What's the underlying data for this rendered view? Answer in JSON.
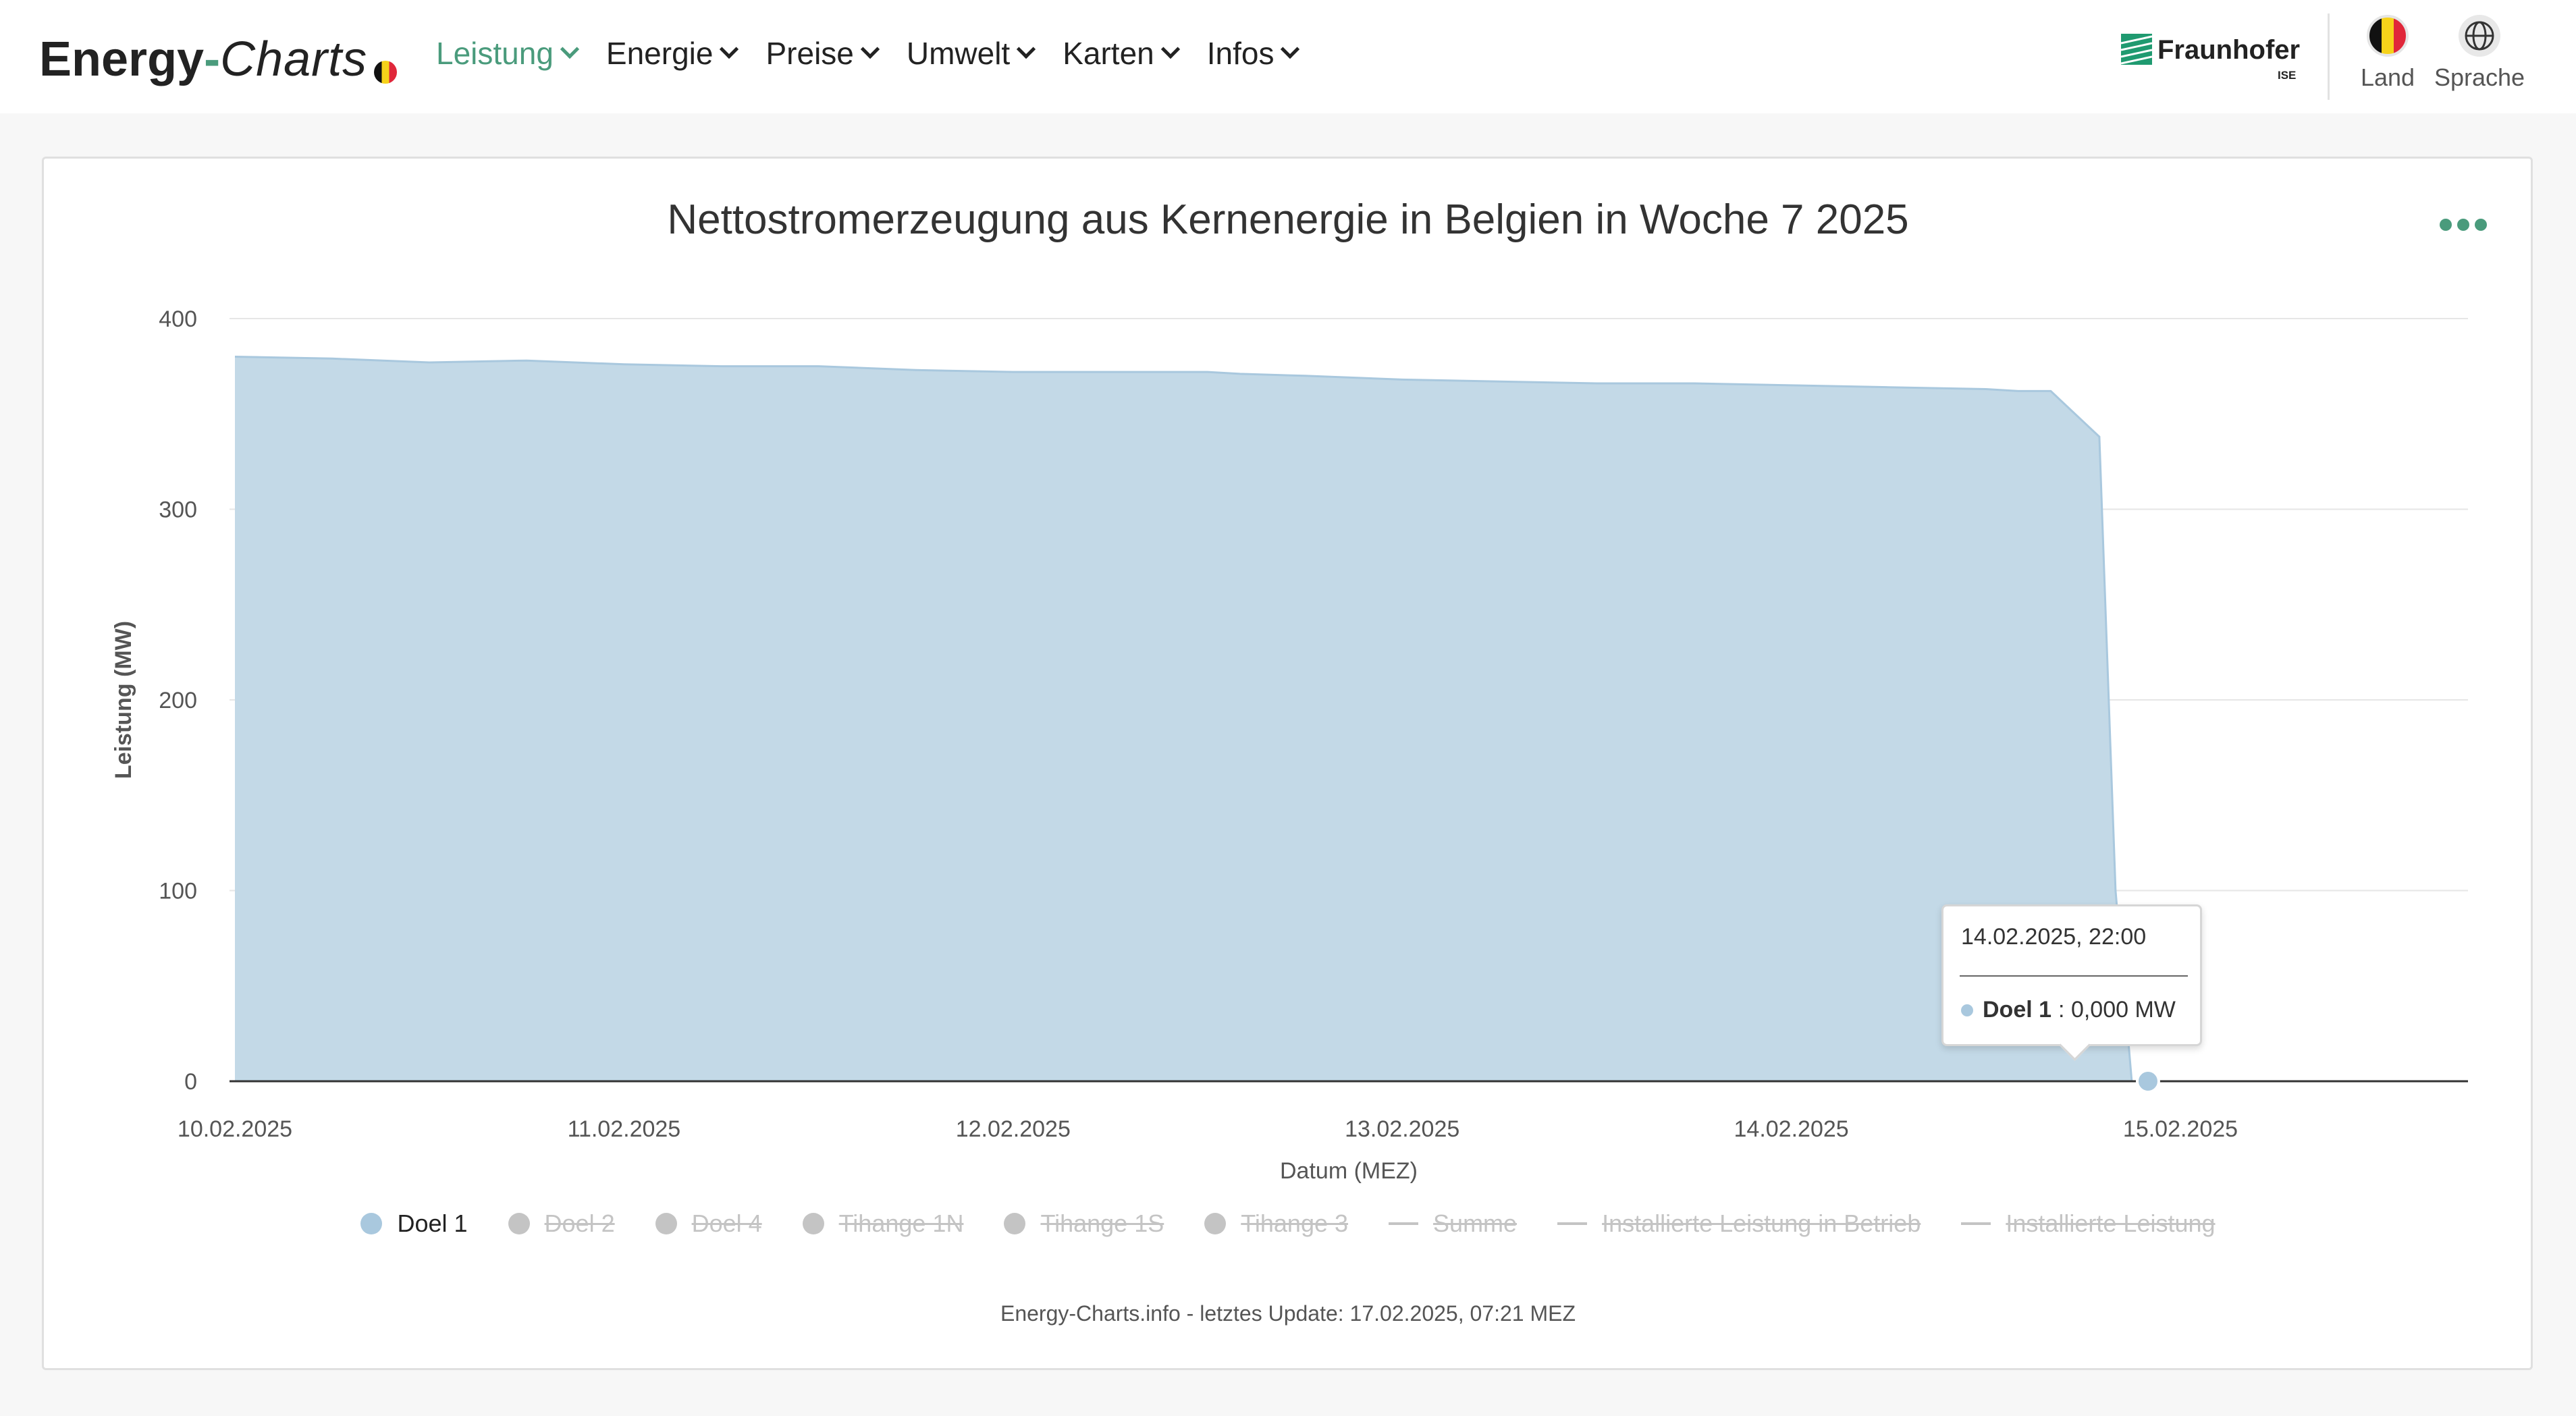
{
  "header": {
    "logo": {
      "part1": "Energy",
      "part2": "-",
      "part3": "Charts"
    },
    "nav": [
      {
        "label": "Leistung",
        "active": true
      },
      {
        "label": "Energie",
        "active": false
      },
      {
        "label": "Preise",
        "active": false
      },
      {
        "label": "Umwelt",
        "active": false
      },
      {
        "label": "Karten",
        "active": false
      },
      {
        "label": "Infos",
        "active": false
      }
    ],
    "partner": {
      "name": "Fraunhofer",
      "sub": "ISE"
    },
    "country_label": "Land",
    "language_label": "Sprache"
  },
  "chart_menu_icon": "more-horizontal-icon",
  "colors": {
    "accent": "#4a9b7c",
    "area": "#c3d9e7",
    "area_stroke": "#a9c8de",
    "hidden": "#c4c4c4"
  },
  "chart_data": {
    "type": "area",
    "title": "Nettostromerzeugung aus Kernenergie in Belgien in Woche 7 2025",
    "xlabel": "Datum (MEZ)",
    "ylabel": "Leistung (MW)",
    "ylim": [
      0,
      400
    ],
    "yticks": [
      0,
      100,
      200,
      300,
      400
    ],
    "xticks": [
      "10.02.2025",
      "11.02.2025",
      "12.02.2025",
      "13.02.2025",
      "14.02.2025",
      "15.02.2025"
    ],
    "grid": true,
    "legend_position": "bottom",
    "series": [
      {
        "name": "Doel 1",
        "visible": true,
        "x": [
          "10.02.2025 00:00",
          "10.02.2025 06:00",
          "10.02.2025 12:00",
          "10.02.2025 18:00",
          "11.02.2025 00:00",
          "11.02.2025 06:00",
          "11.02.2025 12:00",
          "11.02.2025 18:00",
          "12.02.2025 00:00",
          "12.02.2025 06:00",
          "12.02.2025 12:00",
          "12.02.2025 14:00",
          "12.02.2025 18:00",
          "13.02.2025 00:00",
          "13.02.2025 06:00",
          "13.02.2025 12:00",
          "13.02.2025 18:00",
          "14.02.2025 00:00",
          "14.02.2025 06:00",
          "14.02.2025 12:00",
          "14.02.2025 14:00",
          "14.02.2025 15:00",
          "14.02.2025 16:00",
          "14.02.2025 19:00",
          "14.02.2025 20:00",
          "14.02.2025 21:00",
          "14.02.2025 22:00"
        ],
        "values": [
          380,
          379,
          377,
          378,
          376,
          375,
          375,
          373,
          372,
          372,
          372,
          371,
          370,
          368,
          367,
          366,
          366,
          365,
          364,
          363,
          362,
          362,
          362,
          338,
          100,
          0,
          0
        ]
      },
      {
        "name": "Doel 2",
        "visible": false
      },
      {
        "name": "Doel 4",
        "visible": false
      },
      {
        "name": "Tihange 1N",
        "visible": false
      },
      {
        "name": "Tihange 1S",
        "visible": false
      },
      {
        "name": "Tihange 3",
        "visible": false
      },
      {
        "name": "Summe",
        "visible": false
      },
      {
        "name": "Installierte Leistung in Betrieb",
        "visible": false
      },
      {
        "name": "Installierte Leistung",
        "visible": false
      }
    ]
  },
  "legend": [
    {
      "label": "Doel 1",
      "marker": "dot",
      "visible": true
    },
    {
      "label": "Doel 2",
      "marker": "dot",
      "visible": false
    },
    {
      "label": "Doel 4",
      "marker": "dot",
      "visible": false
    },
    {
      "label": "Tihange 1N",
      "marker": "dot",
      "visible": false
    },
    {
      "label": "Tihange 1S",
      "marker": "dot",
      "visible": false
    },
    {
      "label": "Tihange 3",
      "marker": "dot",
      "visible": false
    },
    {
      "label": "Summe",
      "marker": "line",
      "visible": false
    },
    {
      "label": "Installierte Leistung in Betrieb",
      "marker": "line",
      "visible": false
    },
    {
      "label": "Installierte Leistung",
      "marker": "line",
      "visible": false
    }
  ],
  "tooltip": {
    "date": "14.02.2025, 22:00",
    "series": "Doel 1",
    "value": ": 0,000 MW"
  },
  "footer": "Energy-Charts.info - letztes Update: 17.02.2025, 07:21 MEZ"
}
